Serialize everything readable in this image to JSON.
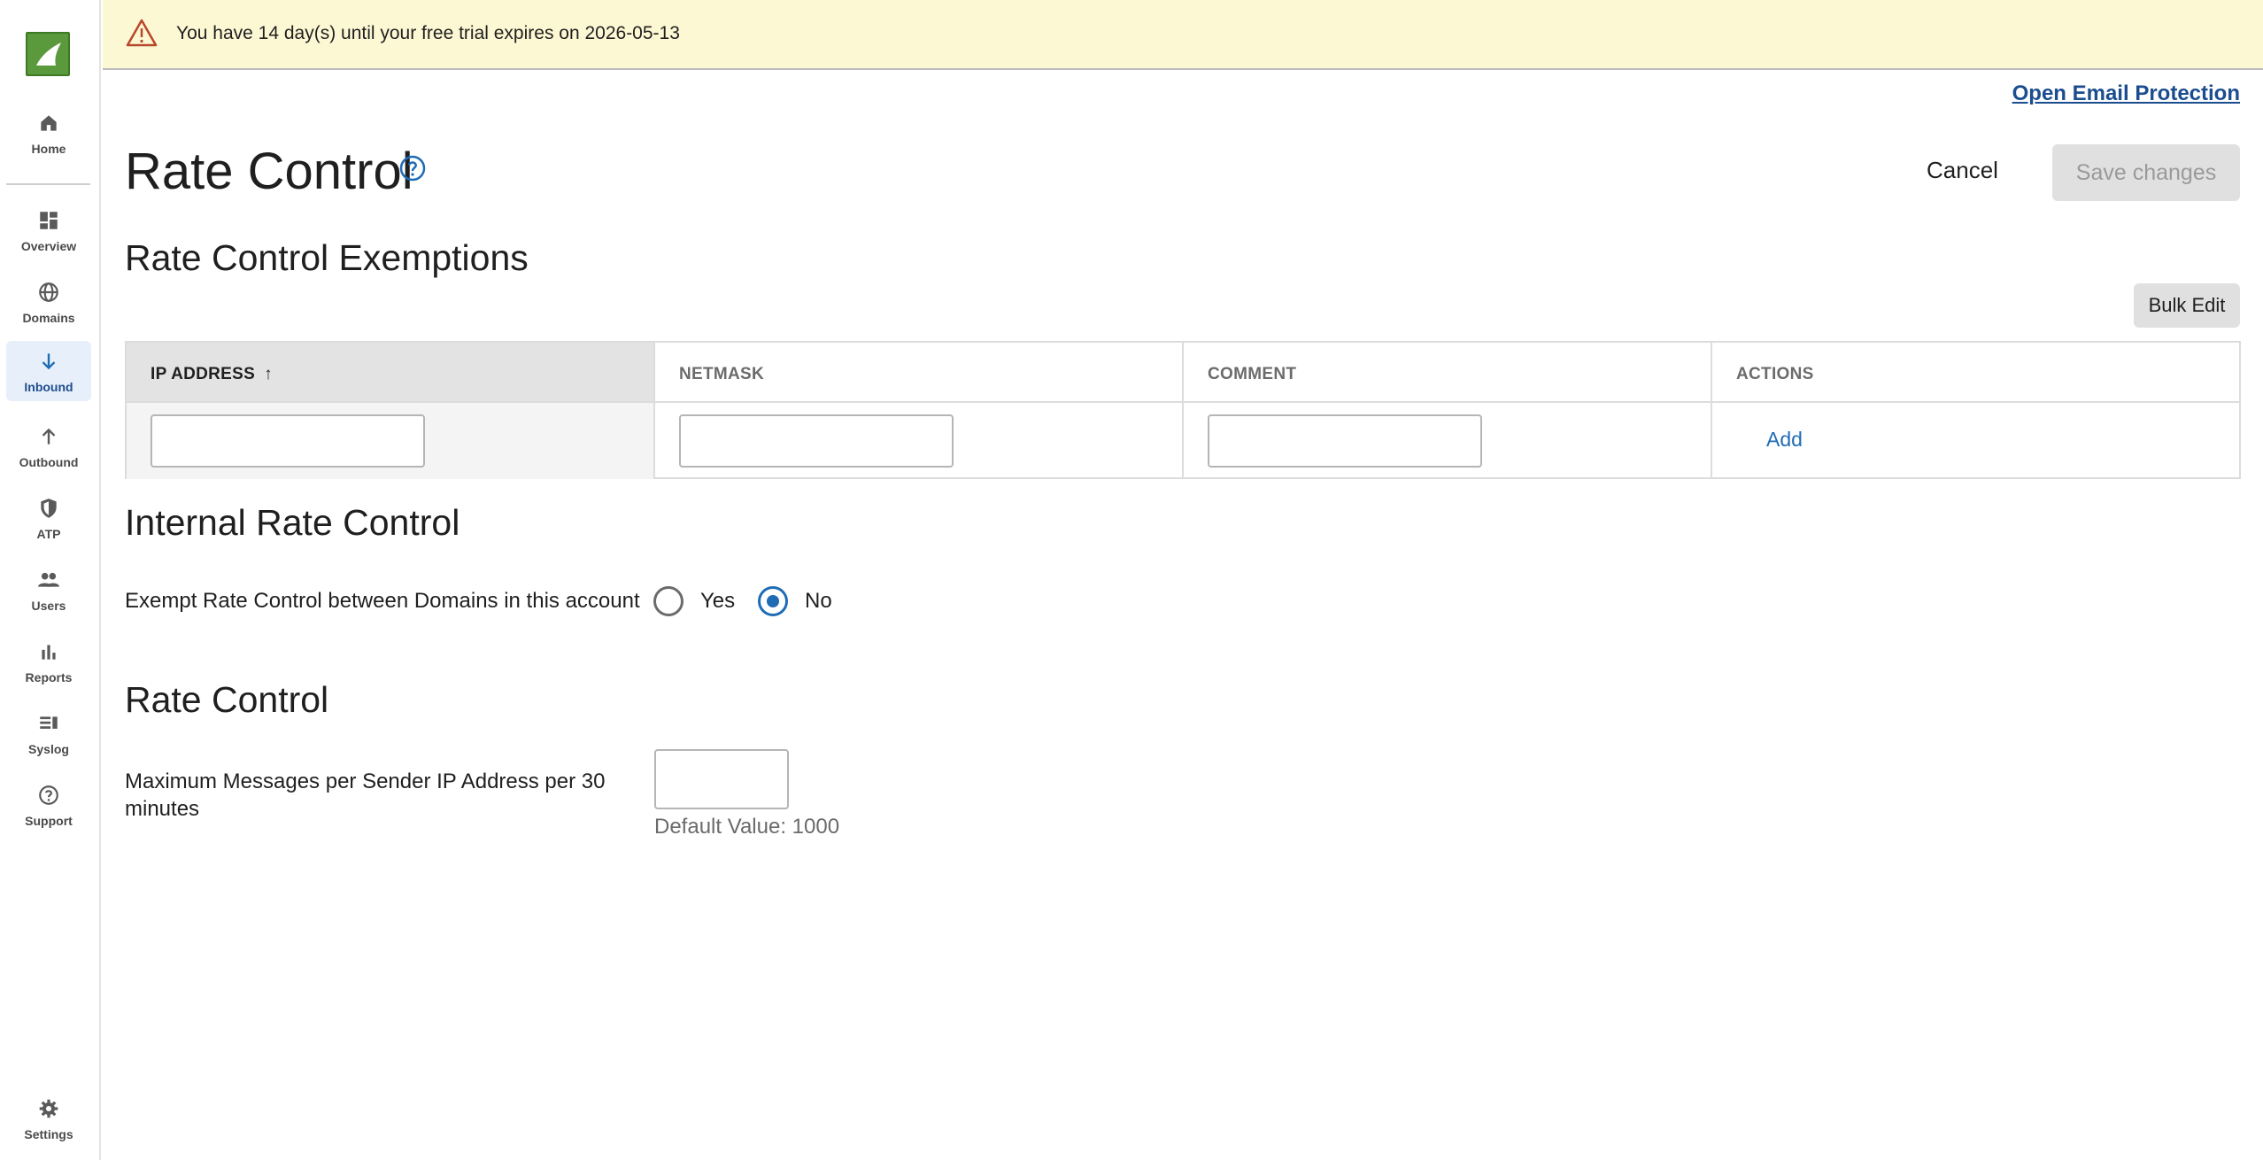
{
  "sidebar": {
    "items": [
      {
        "label": "Home",
        "icon": "home-icon"
      },
      {
        "label": "Overview",
        "icon": "dashboard-icon"
      },
      {
        "label": "Domains",
        "icon": "globe-icon"
      },
      {
        "label": "Inbound",
        "icon": "arrow-down-icon",
        "active": true
      },
      {
        "label": "Outbound",
        "icon": "arrow-up-icon"
      },
      {
        "label": "ATP",
        "icon": "shield-icon"
      },
      {
        "label": "Users",
        "icon": "users-icon"
      },
      {
        "label": "Reports",
        "icon": "bar-chart-icon"
      },
      {
        "label": "Syslog",
        "icon": "syslog-icon"
      },
      {
        "label": "Support",
        "icon": "help-circle-icon"
      }
    ],
    "settings": {
      "label": "Settings",
      "icon": "gear-icon"
    }
  },
  "banner": {
    "message": "You have 14 day(s) until your free trial expires on 2026-05-13"
  },
  "header": {
    "open_link": "Open Email Protection",
    "title": "Rate Control",
    "cancel": "Cancel",
    "save": "Save changes"
  },
  "exemptions": {
    "title": "Rate Control Exemptions",
    "bulk_edit": "Bulk Edit",
    "columns": [
      "IP ADDRESS",
      "NETMASK",
      "COMMENT",
      "ACTIONS"
    ],
    "sort_indicator": "↑",
    "add_label": "Add"
  },
  "internal": {
    "title": "Internal Rate Control",
    "question": "Exempt Rate Control between Domains in this account",
    "options": [
      "Yes",
      "No"
    ],
    "selected": "No"
  },
  "rate": {
    "title": "Rate Control",
    "label": "Maximum Messages per Sender IP Address per 30 minutes",
    "value": "",
    "default_text": "Default Value: 1000"
  },
  "colors": {
    "accent": "#1f6cb5",
    "banner_bg": "#fdf8d4",
    "active_nav_bg": "#e7f0fa"
  }
}
